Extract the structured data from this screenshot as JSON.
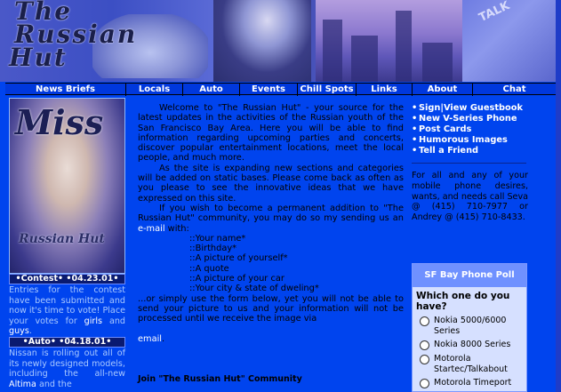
{
  "header": {
    "logo_lines": [
      "The",
      "Russian",
      "Hut"
    ],
    "phone_keys": "TALK"
  },
  "nav": {
    "items": [
      {
        "label": "News Briefs",
        "width": 135
      },
      {
        "label": "Locals",
        "width": 64
      },
      {
        "label": "Auto",
        "width": 64
      },
      {
        "label": "Events",
        "width": 65
      },
      {
        "label": "Chill Spots",
        "width": 66
      },
      {
        "label": "Links",
        "width": 63
      },
      {
        "label": "About",
        "width": 68
      },
      {
        "label": "Chat",
        "width": 94
      }
    ]
  },
  "left": {
    "photo_title": "Miss",
    "photo_logo": "Russian Hut",
    "contest": {
      "header": "•Contest• •04.23.01•",
      "body_pre": "Entries for the contest have been submitted and now it's time to vote! Place your votes for ",
      "girls": "girls",
      "and": " and ",
      "guys": "guys",
      "end": "."
    },
    "auto": {
      "header": "•Auto• •04.18.01•",
      "body_pre": "Nissan is rolling out all of its newly designed models, including the all-new ",
      "altima": "Altima",
      "body_post": " and the"
    }
  },
  "center": {
    "p1": "Welcome to \"The Russian Hut\" - your source for the latest updates in the activities of the Russian youth of the San Francisco Bay Area. Here you will be able to find information regarding upcoming parties and concerts, discover popular entertainment locations, meet the local people, and much more.",
    "p2": "As the site is expanding new sections and categories will be added on static bases. Please come back as often as you please to see the innovative ideas that we have expressed on this site.",
    "p3_pre": "If you wish to become a permanent addition to \"The Russian Hut\" community, you may do so my sending us an ",
    "email_link": "e-mail",
    "p3_post": " with:",
    "list": [
      "::Your name*",
      "::Birthday*",
      "::A picture of yourself*",
      "::A quote",
      "::A picture of your car",
      "::Your city & state of dweling*"
    ],
    "p4": "...or simply use the form below, yet you will not be able to send your picture to us and your information will not be processed until we receive the image via",
    "email_link2": "email",
    "p4_end": ".",
    "join": "Join \"The Russian Hut\" Community"
  },
  "right": {
    "links": [
      {
        "bullet": "•",
        "label": "Sign|View Guestbook"
      },
      {
        "bullet": "•",
        "label": "New V-Series Phone"
      },
      {
        "bullet": "•",
        "label": "Post Cards"
      },
      {
        "bullet": "•",
        "label": "Humorous Images"
      },
      {
        "bullet": "•",
        "label": "Tell a Friend"
      }
    ],
    "phone_text": "For all and any of your mobile phone desires, wants, and needs call Seva @ (415) 710-7977 or Andrey @ (415) 710-8433.",
    "poll": {
      "title": "SF Bay Phone Poll",
      "question": "Which one do you have?",
      "options": [
        "Nokia 5000/6000 Series",
        "Nokia 8000 Series",
        "Motorola Startec/Talkabout",
        "Motorola Timeport"
      ]
    }
  },
  "colors": {
    "page_bg": "#0044ee",
    "nav_bg": "#0038dd",
    "left_text": "#a8c8ff",
    "link_white": "#ffffff",
    "poll_bg": "#d6e0ff",
    "poll_header": "#6f91ff"
  }
}
